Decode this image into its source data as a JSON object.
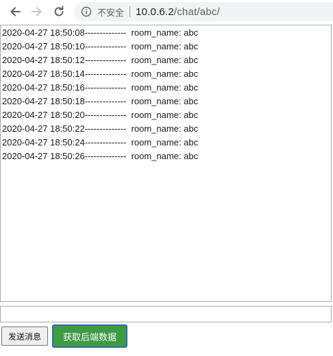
{
  "browser": {
    "security_label": "不安全",
    "url_host": "10.0.6.2",
    "url_path": "/chat/abc/",
    "icons": {
      "back": "back-arrow-icon",
      "forward": "forward-arrow-icon",
      "reload": "reload-icon",
      "info": "info-icon"
    }
  },
  "chat_log": {
    "lines": [
      "2020-04-27 18:50:08--------------  room_name: abc",
      "2020-04-27 18:50:10--------------  room_name: abc",
      "2020-04-27 18:50:12--------------  room_name: abc",
      "2020-04-27 18:50:14--------------  room_name: abc",
      "2020-04-27 18:50:16--------------  room_name: abc",
      "2020-04-27 18:50:18--------------  room_name: abc",
      "2020-04-27 18:50:20--------------  room_name: abc",
      "2020-04-27 18:50:22--------------  room_name: abc",
      "2020-04-27 18:50:24--------------  room_name: abc",
      "2020-04-27 18:50:26--------------  room_name: abc"
    ]
  },
  "message_input": {
    "value": "",
    "placeholder": ""
  },
  "buttons": {
    "send_label": "发送消息",
    "fetch_label": "获取后端数据"
  },
  "colors": {
    "fetch_button_bg": "#3d9a45",
    "fetch_button_border": "#2f6f9f",
    "omnibox_bg": "#f1f3f4"
  }
}
